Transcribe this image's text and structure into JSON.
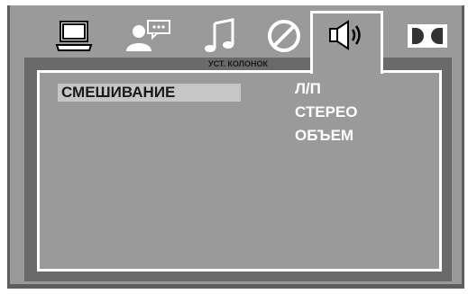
{
  "tabs": [
    {
      "icon": "laptop-icon",
      "active": false
    },
    {
      "icon": "user-chat-icon",
      "active": false
    },
    {
      "icon": "music-note-icon",
      "active": false
    },
    {
      "icon": "disc-icon",
      "active": false
    },
    {
      "icon": "speaker-icon",
      "active": true
    },
    {
      "icon": "dolby-icon",
      "active": false
    }
  ],
  "active_tab_caption": "УСТ. КОЛОНОК",
  "setting": {
    "label": "СМЕШИВАНИЕ",
    "options": [
      "Л/П",
      "СТЕРЕО",
      "ОБЪЕМ"
    ]
  },
  "colors": {
    "background": "#9a9a9a",
    "dark_frame": "#5e5e5e",
    "text_white": "#ffffff",
    "highlight": "#c6c6c6"
  }
}
